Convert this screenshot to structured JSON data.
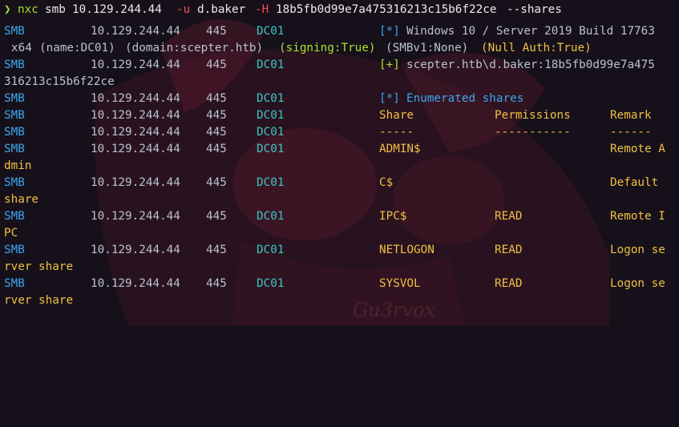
{
  "command": {
    "prompt_symbol": "❯",
    "program": "nxc",
    "protocol": "smb",
    "target": "10.129.244.44",
    "user_flag": "-u",
    "user": "d.baker",
    "hash_flag": "-H",
    "hash": "18b5fb0d99e7a475316213c15b6f22ce",
    "option": "--shares"
  },
  "colors": {
    "background": "#16101a",
    "prompt": "#a6e22e",
    "protocol": "#3aa6ee",
    "success": "#a6e22e",
    "info": "#3aa6ee",
    "share_text": "#f0c043",
    "host": "#3cc7c5",
    "flag": "#f14a5a"
  },
  "prefix": {
    "proto": "SMB",
    "ip": "10.129.244.44",
    "port": "445",
    "host": "DC01"
  },
  "lines": {
    "l1_tag": "[*]",
    "l1_msg": "Windows 10 / Server 2019 Build 17763",
    "l2_x64": "x64",
    "l2_name": "(name:DC01)",
    "l2_domain": "(domain:scepter.htb)",
    "l2_signing": "(signing:True)",
    "l2_smbv1": "(SMBv1:None)",
    "l2_null": "(Null Auth:True)",
    "l3_tag": "[+]",
    "l3_msg": "scepter.htb\\d.baker:18b5fb0d99e7a475",
    "l4_cont": "316213c15b6f22ce",
    "l5_tag": "[*]",
    "l5_msg": "Enumerated shares"
  },
  "table": {
    "headers": [
      "Share",
      "Permissions",
      "Remark"
    ],
    "dashes": [
      "-----",
      "-----------",
      "------"
    ],
    "rows": [
      {
        "share": "ADMIN$",
        "perm": "",
        "remark": "Remote A",
        "cont": "dmin"
      },
      {
        "share": "C$",
        "perm": "",
        "remark": "Default",
        "cont": "share"
      },
      {
        "share": "IPC$",
        "perm": "READ",
        "remark": "Remote I",
        "cont": "PC"
      },
      {
        "share": "NETLOGON",
        "perm": "READ",
        "remark": "Logon se",
        "cont": "rver share"
      },
      {
        "share": "SYSVOL",
        "perm": "READ",
        "remark": "Logon se",
        "cont": "rver share"
      }
    ]
  },
  "watermark": "Gu3rvox"
}
